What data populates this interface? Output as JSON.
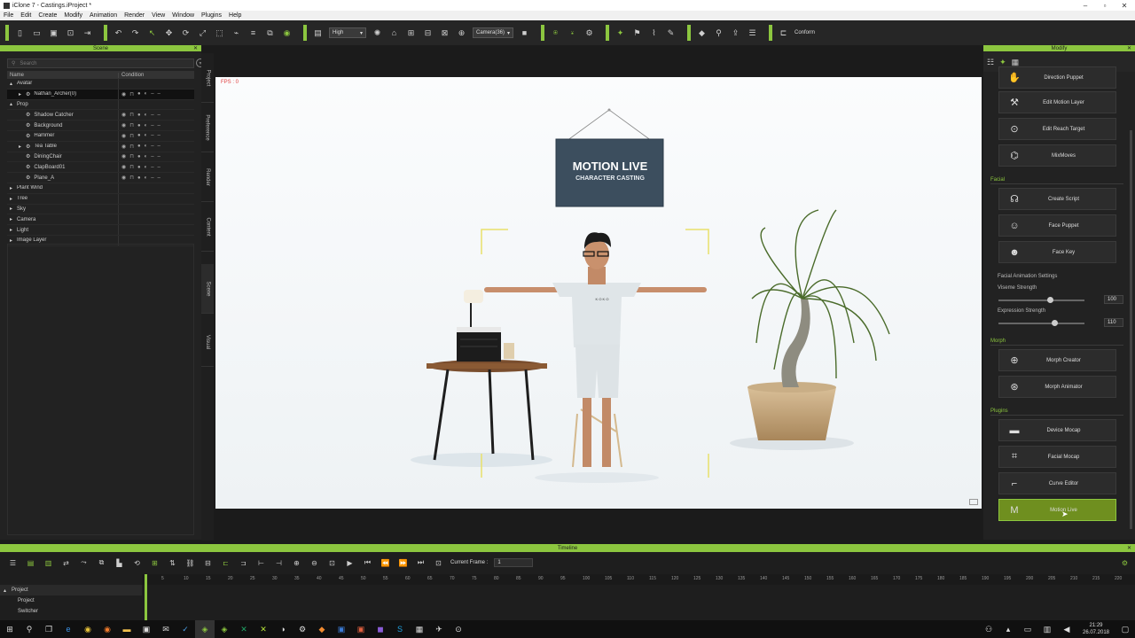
{
  "window": {
    "title": "iClone 7 - Castings.iProject *"
  },
  "menu": [
    "File",
    "Edit",
    "Create",
    "Modify",
    "Animation",
    "Render",
    "View",
    "Window",
    "Plugins",
    "Help"
  ],
  "toolbar": {
    "quality": "High",
    "camera": "Camera(36)",
    "conform": "Conform"
  },
  "scene": {
    "title": "Scene",
    "search_placeholder": "Search",
    "col_name": "Name",
    "col_condition": "Condition",
    "rows": [
      {
        "label": "Avatar",
        "level": 0,
        "exp": "▴"
      },
      {
        "label": "Nathan_Archer(0)",
        "level": 2,
        "exp": "▸",
        "sel": true
      },
      {
        "label": "Prop",
        "level": 0,
        "exp": "▴"
      },
      {
        "label": "Shadow Catcher",
        "level": 2,
        "exp": ""
      },
      {
        "label": "Background",
        "level": 2,
        "exp": ""
      },
      {
        "label": "Hammer",
        "level": 2,
        "exp": ""
      },
      {
        "label": "Tea Table",
        "level": 2,
        "exp": "▸"
      },
      {
        "label": "DiningChair",
        "level": 2,
        "exp": ""
      },
      {
        "label": "ClapBoard01",
        "level": 2,
        "exp": ""
      },
      {
        "label": "Plane_A",
        "level": 2,
        "exp": ""
      },
      {
        "label": "Plant Wind",
        "level": 0,
        "exp": "▸"
      },
      {
        "label": "Tree",
        "level": 0,
        "exp": "▸"
      },
      {
        "label": "Sky",
        "level": 0,
        "exp": "▸"
      },
      {
        "label": "Camera",
        "level": 0,
        "exp": "▸"
      },
      {
        "label": "Light",
        "level": 0,
        "exp": "▸"
      },
      {
        "label": "Image Layer",
        "level": 0,
        "exp": "▸"
      }
    ]
  },
  "sidetabs": [
    "Project",
    "Preference",
    "Render",
    "Content",
    "Scene",
    "Visual"
  ],
  "viewport": {
    "fps": "FPS : 0",
    "sign_line1": "MOTION LIVE",
    "sign_line2": "CHARACTER CASTING",
    "shirt": "K O K O"
  },
  "modify": {
    "title": "Modify",
    "items": [
      "Direction Puppet",
      "Edit Motion Layer",
      "Edit Reach Target",
      "MixMoves"
    ],
    "facial_title": "Facial",
    "facial": [
      "Create Script",
      "Face Puppet",
      "Face Key"
    ],
    "settings_title": "Facial Animation Settings",
    "viseme_label": "Viseme Strength",
    "viseme_value": "100",
    "viseme_level": 0.6,
    "expression_label": "Expression Strength",
    "expression_value": "110",
    "expression_level": 0.65,
    "morph_title": "Morph",
    "morph": [
      "Morph Creator",
      "Morph Animator"
    ],
    "plugins_title": "Plugins",
    "plugins": [
      "Device Mocap",
      "Facial Mocap",
      "Curve Editor",
      "Motion Live"
    ]
  },
  "timeline": {
    "title": "Timeline",
    "current_frame_label": "Current Frame :",
    "current_frame": "1",
    "tracks": [
      "Project",
      "Project",
      "Switcher"
    ],
    "ruler": [
      "5",
      "10",
      "15",
      "20",
      "25",
      "30",
      "35",
      "40",
      "45",
      "50",
      "55",
      "60",
      "65",
      "70",
      "75",
      "80",
      "85",
      "90",
      "95",
      "100",
      "105",
      "110",
      "115",
      "120",
      "125",
      "130",
      "135",
      "140",
      "145",
      "150",
      "155",
      "160",
      "165",
      "170",
      "175",
      "180",
      "185",
      "190",
      "195",
      "200",
      "205",
      "210",
      "215",
      "220"
    ]
  },
  "taskbar": {
    "time": "21:29",
    "date": "26.07.2018"
  },
  "colors": {
    "accent": "#8cc63f"
  }
}
